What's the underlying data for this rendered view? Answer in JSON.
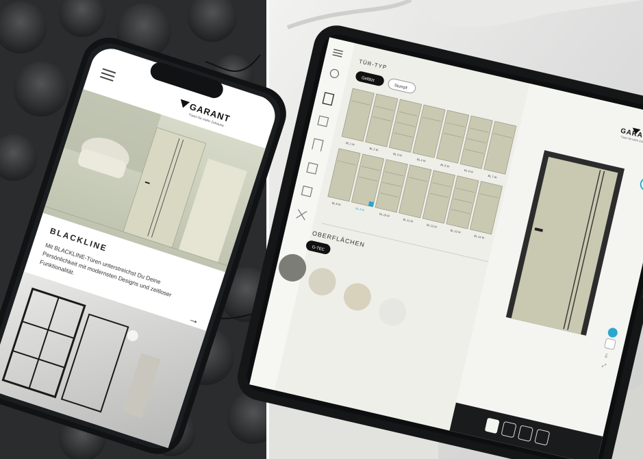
{
  "phone": {
    "brand": "GARANT",
    "brand_tagline": "Türen für mehr Zuhause",
    "article_title": "BLACKLINE",
    "article_lines": [
      "Mit BLACKLINE-Türen unterstreichst Du Deine",
      "Persönlichkeit mit modernsten Designs und zeitloser",
      "Funktionalität."
    ],
    "next_arrow": "→"
  },
  "tablet": {
    "brand": "GARANT",
    "brand_tagline": "Türen für mehr Zuhause",
    "section_door_type": "TÜR-TYP",
    "tabs": [
      "Gefälzt",
      "Stumpf"
    ],
    "section_surfaces": "OBERFLÄCHEN",
    "surface_chip": "G-TEC",
    "door_codes_row1": [
      "BL 1 W",
      "BL 2 W",
      "BL 3 W",
      "BL 4 W",
      "BL 5 W",
      "BL 6 W",
      "BL 7 W"
    ],
    "door_codes_row2": [
      "BL 8 W",
      "BL 9 W",
      "BL 10 W",
      "BL 11 W",
      "BL 12 W",
      "BL 13 W",
      "BL 14 W"
    ]
  },
  "colors": {
    "door_panel": "#c9c9b2",
    "door_stroke": "#8a8a76",
    "tablet_screen": "#efefe9",
    "accent": "#2aa7cf"
  }
}
